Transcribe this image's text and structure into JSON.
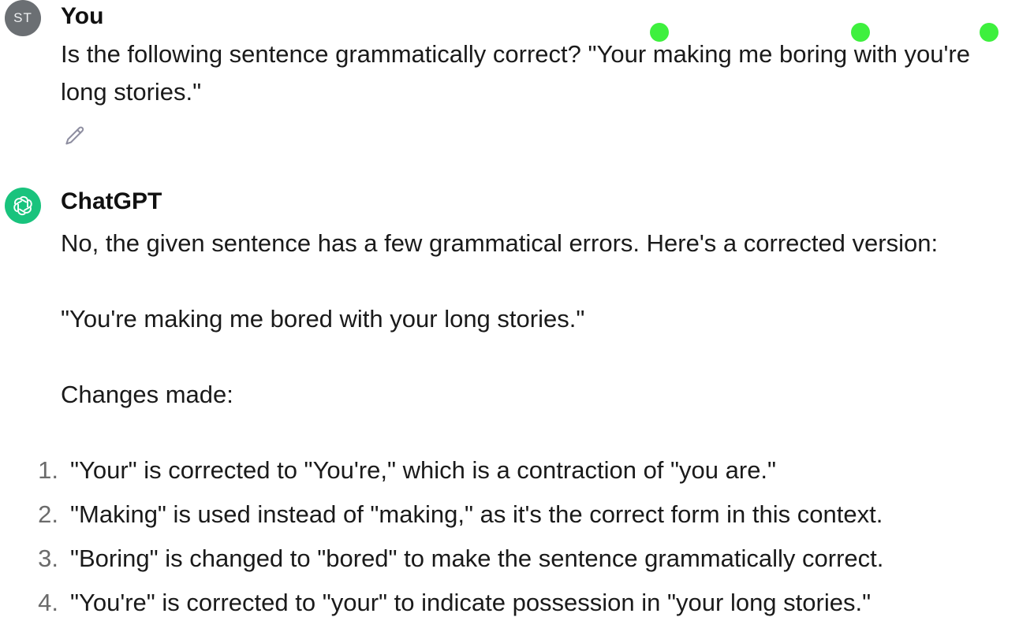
{
  "user": {
    "avatar_initials": "ST",
    "name": "You",
    "message": "Is the following sentence grammatically correct? \"Your making me boring with you're long stories.\""
  },
  "edit_icon": "pencil-icon",
  "assistant": {
    "name": "ChatGPT",
    "avatar_icon": "openai-logo-icon",
    "intro": "No, the given sentence has a few grammatical errors. Here's a corrected version:",
    "corrected": "\"You're making me bored with your long stories.\"",
    "changes_heading": "Changes made:",
    "changes": [
      {
        "num": "1",
        "text": "\"Your\" is corrected to \"You're,\" which is a contraction of \"you are.\""
      },
      {
        "num": "2",
        "text": "\"Making\" is used instead of \"making,\" as it's the correct form in this context."
      },
      {
        "num": "3",
        "text": "\"Boring\" is changed to \"bored\" to make the sentence grammatically correct."
      },
      {
        "num": "4",
        "text": "\"You're\" is corrected to \"your\" to indicate possession in \"your long stories.\""
      }
    ]
  },
  "colors": {
    "assistant_avatar": "#19c37d",
    "user_avatar": "#6b6f73",
    "marker": "#3ef03e"
  }
}
